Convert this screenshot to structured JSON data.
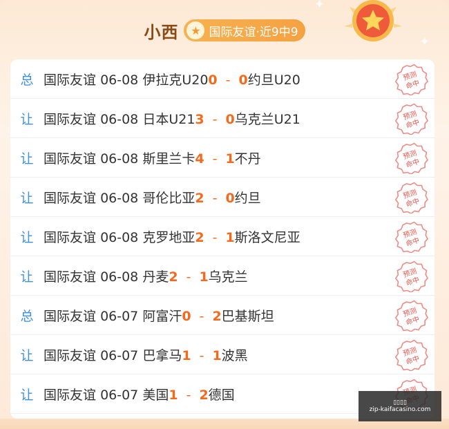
{
  "header": {
    "name": "小西",
    "tag_label": "国际友谊·近9中9",
    "tag_icon": "star-icon",
    "medal_icon": "star-medal-icon"
  },
  "colors": {
    "type_blue": "#3d8fe0",
    "score_orange": "#f4691c",
    "stamp_red": "#e8574f"
  },
  "stamp": {
    "line1": "预测",
    "line2": "命中"
  },
  "matches": [
    {
      "type": "总",
      "league": "国际友谊",
      "date": "06-08",
      "home": "伊拉克U20",
      "home_score": "0",
      "away_score": "0",
      "away": "约旦U20"
    },
    {
      "type": "让",
      "league": "国际友谊",
      "date": "06-08",
      "home": "日本U21",
      "home_score": "3",
      "away_score": "0",
      "away": "乌克兰U21"
    },
    {
      "type": "让",
      "league": "国际友谊",
      "date": "06-08",
      "home": "斯里兰卡",
      "home_score": "4",
      "away_score": "1",
      "away": "不丹"
    },
    {
      "type": "让",
      "league": "国际友谊",
      "date": "06-08",
      "home": "哥伦比亚",
      "home_score": "2",
      "away_score": "0",
      "away": "约旦"
    },
    {
      "type": "让",
      "league": "国际友谊",
      "date": "06-08",
      "home": "克罗地亚",
      "home_score": "2",
      "away_score": "1",
      "away": "斯洛文尼亚"
    },
    {
      "type": "让",
      "league": "国际友谊",
      "date": "06-08",
      "home": "丹麦",
      "home_score": "2",
      "away_score": "1",
      "away": "乌克兰"
    },
    {
      "type": "总",
      "league": "国际友谊",
      "date": "06-07",
      "home": "阿富汗",
      "home_score": "0",
      "away_score": "2",
      "away": "巴基斯坦"
    },
    {
      "type": "让",
      "league": "国际友谊",
      "date": "06-07",
      "home": "巴拿马",
      "home_score": "1",
      "away_score": "1",
      "away": "波黑"
    },
    {
      "type": "让",
      "league": "国际友谊",
      "date": "06-07",
      "home": "美国",
      "home_score": "1",
      "away_score": "2",
      "away": "德国"
    }
  ],
  "watermark": {
    "line1": "▯▯▯▯",
    "line2": "zip-kaifacasino.com"
  }
}
